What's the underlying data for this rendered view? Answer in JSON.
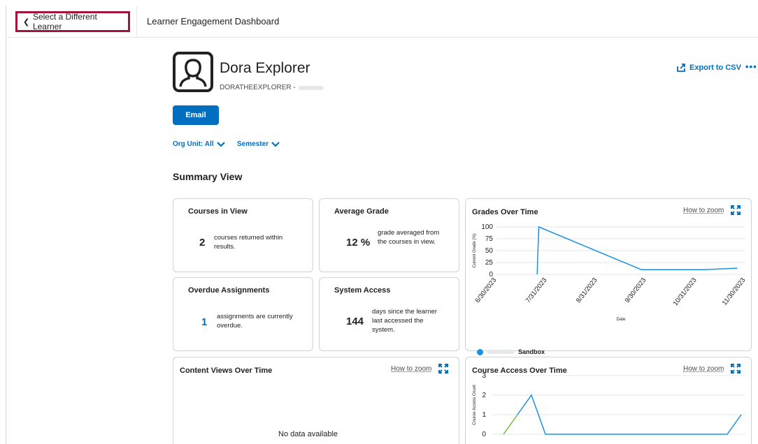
{
  "header": {
    "back_label": "Select a Different Learner",
    "title": "Learner Engagement Dashboard"
  },
  "learner": {
    "name": "Dora Explorer",
    "username": "DORATHEEXPLORER -"
  },
  "actions": {
    "export_label": "Export to CSV",
    "more_label": "•••",
    "email_label": "Email"
  },
  "filters": {
    "org_unit": "Org Unit: All",
    "semester": "Semester"
  },
  "summary": {
    "title": "Summary View",
    "cards": {
      "courses": {
        "title": "Courses in View",
        "value": "2",
        "desc": "courses returned within results."
      },
      "grade": {
        "title": "Average Grade",
        "value": "12 %",
        "desc": "grade averaged from the courses in view."
      },
      "overdue": {
        "title": "Overdue Assignments",
        "value": "1",
        "desc": "assignments are currently overdue."
      },
      "access": {
        "title": "System Access",
        "value": "144",
        "desc": "days since the learner last accessed the system."
      }
    }
  },
  "charts_ui": {
    "zoom_label": "How to zoom",
    "no_data": "No data available",
    "content_views_title": "Content Views Over Time"
  },
  "colors": {
    "primary": "#006fbf",
    "highlight_border": "#a3143c",
    "series_blue": "#1a92e4",
    "series_green": "#63c13f"
  },
  "chart_data": [
    {
      "type": "line",
      "title": "Grades Over Time",
      "xlabel": "Date",
      "ylabel": "Current Grade (%)",
      "ylim": [
        0,
        100
      ],
      "yticks": [
        "0",
        "25",
        "50",
        "75",
        "100"
      ],
      "xticks": [
        "6/30/2023",
        "7/31/2023",
        "8/31/2023",
        "9/30/2023",
        "10/31/2023",
        "11/30/2023"
      ],
      "series": [
        {
          "name": "Sandbox",
          "points": [
            {
              "x": "2023-07-25",
              "y": 0
            },
            {
              "x": "2023-07-26",
              "y": 100
            },
            {
              "x": "2023-09-27",
              "y": 10
            },
            {
              "x": "2023-11-05",
              "y": 10
            },
            {
              "x": "2023-11-25",
              "y": 13
            }
          ]
        }
      ],
      "legend_position": "bottom-left"
    },
    {
      "type": "line",
      "title": "Course Access Over Time",
      "ylabel": "Course Access Count",
      "ylim": [
        0,
        3
      ],
      "yticks": [
        "0",
        "1",
        "2",
        "3"
      ],
      "x": [
        0,
        1,
        2,
        3,
        4,
        5,
        6,
        7,
        8,
        9,
        10,
        11,
        12,
        13,
        14,
        15,
        16,
        17
      ],
      "series": [
        {
          "name": "",
          "values": [
            0,
            1,
            2,
            0,
            0,
            0,
            0,
            0,
            0,
            0,
            0,
            0,
            0,
            0,
            0,
            0,
            0,
            1
          ]
        }
      ]
    }
  ]
}
